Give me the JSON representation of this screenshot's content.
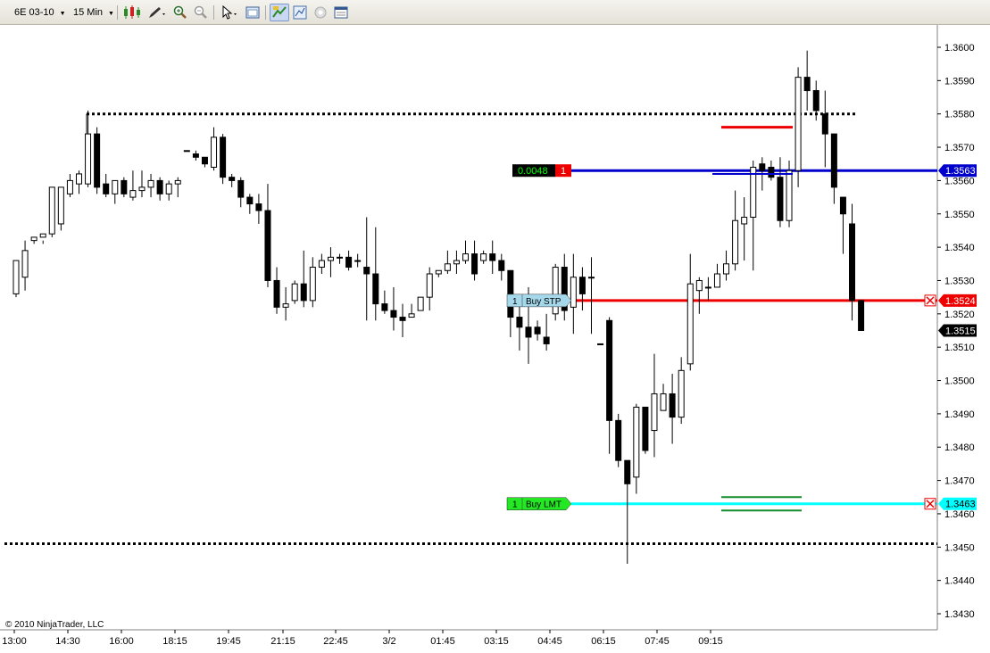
{
  "toolbar": {
    "instrument": "6E 03-10",
    "interval": "15 Min",
    "icons": [
      "candlestick-style-icon",
      "draw-pencil-icon",
      "zoom-in-icon",
      "zoom-out-icon",
      "cursor-icon",
      "chart-properties-icon",
      "chart-trader-icon",
      "strategy-icon",
      "indicator-icon",
      "data-box-icon"
    ],
    "accent": "#7c99c9"
  },
  "copyright": "© 2010 NinjaTrader, LLC",
  "chart_data": {
    "type": "candlestick",
    "ylim": [
      1.3425,
      1.3606
    ],
    "y_ticks": [
      "1.3600",
      "1.3590",
      "1.3580",
      "1.3570",
      "1.3560",
      "1.3550",
      "1.3540",
      "1.3530",
      "1.3520",
      "1.3510",
      "1.3500",
      "1.3490",
      "1.3480",
      "1.3470",
      "1.3460",
      "1.3450",
      "1.3440",
      "1.3430"
    ],
    "x_ticks": [
      "13:00",
      "14:30",
      "16:00",
      "18:15",
      "19:45",
      "21:15",
      "22:45",
      "3/2",
      "01:45",
      "03:15",
      "04:45",
      "06:15",
      "07:45",
      "09:15"
    ],
    "candles": [
      [
        1.3526,
        1.3536,
        1.3525,
        1.3531
      ],
      [
        1.3531,
        1.3539,
        1.3527,
        1.3542
      ],
      [
        1.3542,
        1.3543,
        1.3541,
        1.3543
      ],
      [
        1.3543,
        1.3544,
        1.3541,
        1.3542
      ],
      [
        1.3544,
        1.3558,
        1.3543,
        1.3558
      ],
      [
        1.3547,
        1.3558,
        1.3545,
        1.3557
      ],
      [
        1.3556,
        1.356,
        1.3555,
        1.3562
      ],
      [
        1.3559,
        1.3562,
        1.3556,
        1.3563
      ],
      [
        1.3559,
        1.3574,
        1.3558,
        1.3581
      ],
      [
        1.3574,
        1.3558,
        1.3556,
        1.3576
      ],
      [
        1.3559,
        1.3556,
        1.3555,
        1.3562
      ],
      [
        1.3556,
        1.356,
        1.3553,
        1.356
      ],
      [
        1.356,
        1.3556,
        1.3555,
        1.3561
      ],
      [
        1.3555,
        1.3557,
        1.3554,
        1.3563
      ],
      [
        1.3557,
        1.3558,
        1.3555,
        1.3563
      ],
      [
        1.3558,
        1.356,
        1.3555,
        1.3562
      ],
      [
        1.356,
        1.3556,
        1.3554,
        1.3561
      ],
      [
        1.3556,
        1.3559,
        1.3554,
        1.356
      ],
      [
        1.3559,
        1.356,
        1.3555,
        1.3561
      ],
      [
        1.3569,
        1.3569,
        1.3569,
        1.3569
      ],
      [
        1.3568,
        1.3567,
        1.3566,
        1.3569
      ],
      [
        1.3567,
        1.3565,
        1.3564,
        1.3567
      ],
      [
        1.3564,
        1.3573,
        1.3563,
        1.3576
      ],
      [
        1.3573,
        1.3561,
        1.3559,
        1.3574
      ],
      [
        1.3561,
        1.356,
        1.3558,
        1.3562
      ],
      [
        1.356,
        1.3555,
        1.3552,
        1.3561
      ],
      [
        1.3555,
        1.3553,
        1.355,
        1.3556
      ],
      [
        1.3553,
        1.3551,
        1.3547,
        1.3556
      ],
      [
        1.3551,
        1.353,
        1.3528,
        1.3559
      ],
      [
        1.353,
        1.3522,
        1.352,
        1.3534
      ],
      [
        1.3522,
        1.3523,
        1.3518,
        1.3528
      ],
      [
        1.3524,
        1.3529,
        1.3523,
        1.353
      ],
      [
        1.3529,
        1.3524,
        1.3522,
        1.3539
      ],
      [
        1.3524,
        1.3534,
        1.3522,
        1.3537
      ],
      [
        1.3534,
        1.3536,
        1.3532,
        1.3538
      ],
      [
        1.3536,
        1.3537,
        1.3531,
        1.354
      ],
      [
        1.3537,
        1.3537,
        1.3535,
        1.3538
      ],
      [
        1.3537,
        1.3534,
        1.3533,
        1.3539
      ],
      [
        1.3536,
        1.3536,
        1.3534,
        1.3538
      ],
      [
        1.3534,
        1.3532,
        1.3518,
        1.3549
      ],
      [
        1.3532,
        1.3523,
        1.3518,
        1.3546
      ],
      [
        1.3523,
        1.3521,
        1.352,
        1.3527
      ],
      [
        1.3521,
        1.3519,
        1.3515,
        1.3528
      ],
      [
        1.3519,
        1.3518,
        1.3513,
        1.3523
      ],
      [
        1.3519,
        1.352,
        1.3519,
        1.3523
      ],
      [
        1.3521,
        1.3525,
        1.3521,
        1.3525
      ],
      [
        1.3525,
        1.3532,
        1.3521,
        1.3534
      ],
      [
        1.3532,
        1.3533,
        1.3531,
        1.3533
      ],
      [
        1.3533,
        1.3535,
        1.3532,
        1.3539
      ],
      [
        1.3535,
        1.3536,
        1.3532,
        1.3539
      ],
      [
        1.3536,
        1.3538,
        1.3535,
        1.3542
      ],
      [
        1.3538,
        1.3532,
        1.353,
        1.3542
      ],
      [
        1.3536,
        1.3538,
        1.3535,
        1.3539
      ],
      [
        1.3538,
        1.3536,
        1.3532,
        1.3542
      ],
      [
        1.3536,
        1.3533,
        1.353,
        1.3538
      ],
      [
        1.3533,
        1.3519,
        1.3513,
        1.3533
      ],
      [
        1.3519,
        1.3516,
        1.3509,
        1.3524
      ],
      [
        1.3516,
        1.3513,
        1.3505,
        1.3528
      ],
      [
        1.3516,
        1.3514,
        1.3512,
        1.3518
      ],
      [
        1.3513,
        1.3511,
        1.3509,
        1.352
      ],
      [
        1.352,
        1.3534,
        1.3518,
        1.3535
      ],
      [
        1.3534,
        1.3521,
        1.3518,
        1.3538
      ],
      [
        1.3522,
        1.3531,
        1.3514,
        1.3538
      ],
      [
        1.3531,
        1.3526,
        1.3521,
        1.3534
      ],
      [
        1.3531,
        1.3531,
        1.3514,
        1.3537
      ],
      [
        1.3511,
        1.3511,
        1.3511,
        1.3511
      ],
      [
        1.3518,
        1.3488,
        1.3478,
        1.3519
      ],
      [
        1.3488,
        1.3476,
        1.3474,
        1.349
      ],
      [
        1.3476,
        1.3469,
        1.3445,
        1.3474
      ],
      [
        1.3471,
        1.3492,
        1.3466,
        1.3493
      ],
      [
        1.3492,
        1.3479,
        1.3478,
        1.3492
      ],
      [
        1.3485,
        1.3496,
        1.3477,
        1.3508
      ],
      [
        1.3491,
        1.3496,
        1.3492,
        1.3499
      ],
      [
        1.3496,
        1.3489,
        1.3481,
        1.3502
      ],
      [
        1.3489,
        1.3503,
        1.3487,
        1.3507
      ],
      [
        1.3505,
        1.3529,
        1.3503,
        1.3538
      ],
      [
        1.3527,
        1.353,
        1.352,
        1.3531
      ],
      [
        1.3528,
        1.3528,
        1.3524,
        1.3531
      ],
      [
        1.3528,
        1.3532,
        1.3528,
        1.3535
      ],
      [
        1.3532,
        1.3535,
        1.353,
        1.3539
      ],
      [
        1.3535,
        1.3548,
        1.3533,
        1.3557
      ],
      [
        1.3547,
        1.3549,
        1.3536,
        1.3555
      ],
      [
        1.3549,
        1.3564,
        1.3533,
        1.3566
      ],
      [
        1.3565,
        1.3563,
        1.3557,
        1.3567
      ],
      [
        1.3564,
        1.3561,
        1.356,
        1.3566
      ],
      [
        1.3561,
        1.3548,
        1.3546,
        1.3567
      ],
      [
        1.3548,
        1.3563,
        1.3546,
        1.3566
      ],
      [
        1.3563,
        1.3591,
        1.3558,
        1.3594
      ],
      [
        1.3591,
        1.3587,
        1.3581,
        1.3599
      ],
      [
        1.3587,
        1.3581,
        1.3578,
        1.359
      ],
      [
        1.358,
        1.3574,
        1.3564,
        1.3587
      ],
      [
        1.3574,
        1.3558,
        1.3553,
        1.3569
      ],
      [
        1.3555,
        1.355,
        1.3538,
        1.3554
      ],
      [
        1.3547,
        1.3524,
        1.3518,
        1.3553
      ],
      [
        1.3524,
        1.3515,
        1.3515,
        1.3524
      ]
    ],
    "horizontal_lines": [
      {
        "price": 1.358,
        "style": "dotted",
        "color": "#000000"
      },
      {
        "price": 1.3451,
        "style": "dotted",
        "color": "#000000"
      },
      {
        "price": 1.3563,
        "style": "solid",
        "color": "#0000cc"
      },
      {
        "price": 1.3524,
        "style": "solid",
        "color": "#ee0000"
      },
      {
        "price": 1.3463,
        "style": "solid",
        "color": "#00ffff"
      }
    ],
    "orders": [
      {
        "qty": "1",
        "label": "Buy STP",
        "price_label": "1.3524",
        "color": "#ee0000"
      },
      {
        "qty": "1",
        "label": "Buy LMT",
        "price_label": "1.3463",
        "color": "#00ffff"
      }
    ],
    "position": {
      "pnl": "0.0048",
      "qty": "1",
      "price_label": "1.3563",
      "color": "#0000cc"
    },
    "last_price": "1.3515",
    "colors": {
      "up": "#ffffff",
      "down": "#000000",
      "position_pnl_bg": "#000000",
      "position_pnl_fg": "#00ff00",
      "buy_stp_bg": "#a6d8ec",
      "buy_lmt_bg": "#23e823",
      "red": "#ee0000",
      "green": "#138c2c"
    }
  }
}
